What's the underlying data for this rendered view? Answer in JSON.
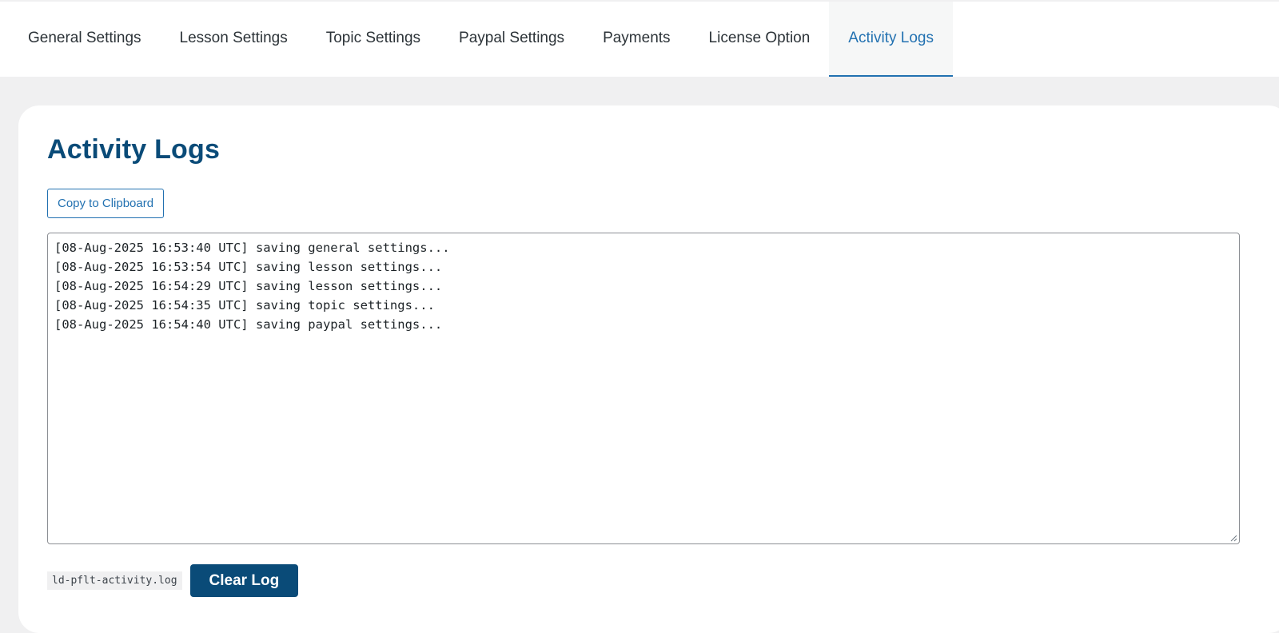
{
  "tabs": [
    {
      "label": "General Settings",
      "active": false
    },
    {
      "label": "Lesson Settings",
      "active": false
    },
    {
      "label": "Topic Settings",
      "active": false
    },
    {
      "label": "Paypal Settings",
      "active": false
    },
    {
      "label": "Payments",
      "active": false
    },
    {
      "label": "License Option",
      "active": false
    },
    {
      "label": "Activity Logs",
      "active": true
    }
  ],
  "page": {
    "title": "Activity Logs",
    "copy_button_label": "Copy to Clipboard",
    "log_lines": [
      "[08-Aug-2025 16:53:40 UTC] saving general settings...",
      "[08-Aug-2025 16:53:54 UTC] saving lesson settings...",
      "[08-Aug-2025 16:54:29 UTC] saving lesson settings...",
      "[08-Aug-2025 16:54:35 UTC] saving topic settings...",
      "[08-Aug-2025 16:54:40 UTC] saving paypal settings..."
    ],
    "log_filename": "ld-pflt-activity.log",
    "clear_button_label": "Clear Log"
  },
  "colors": {
    "accent": "#2271b1",
    "primary_dark": "#0a4b78",
    "page_bg": "#f0f0f1"
  },
  "icons": {
    "resize_handle": "resize-grip-icon"
  }
}
